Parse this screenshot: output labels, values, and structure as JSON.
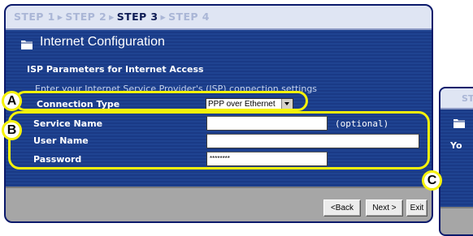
{
  "steps": {
    "step1": "STEP 1",
    "step2": "STEP 2",
    "step3": "STEP 3",
    "step4": "STEP 4",
    "separator": "▸"
  },
  "header": {
    "title": "Internet Configuration",
    "folder_icon": "folder-icon"
  },
  "section": {
    "title": "ISP Parameters for Internet Access",
    "instruction": "Enter your Internet Service Provider's (ISP) connection settings"
  },
  "form": {
    "connection_type_label": "Connection Type",
    "connection_type_value": "PPP over Ethernet",
    "service_name_label": "Service Name",
    "service_name_value": "",
    "service_name_hint": "(optional)",
    "user_name_label": "User Name",
    "user_name_value": "",
    "password_label": "Password",
    "password_value": "********"
  },
  "buttons": {
    "back": "<Back",
    "next": "Next >",
    "exit": "Exit"
  },
  "callouts": {
    "a": "A",
    "b": "B",
    "c": "C"
  },
  "second_panel": {
    "step_text": "STE",
    "partial_text": "Yo"
  },
  "colors": {
    "panel_blue": "#1a3a86",
    "highlight_yellow": "#f5f20a",
    "step_bar": "#dfe5f3",
    "button_bar": "#a6a6a6"
  }
}
